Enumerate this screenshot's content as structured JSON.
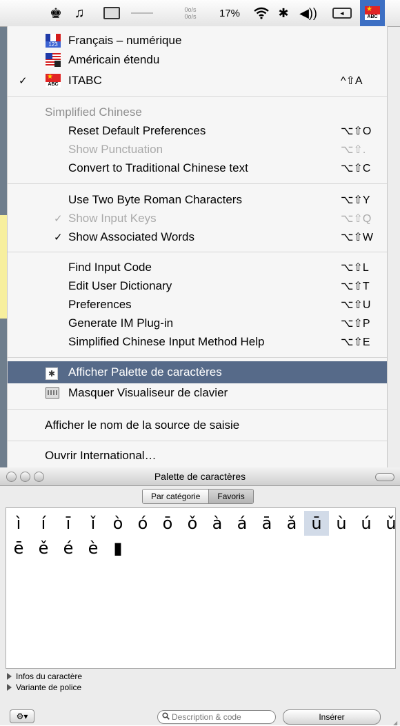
{
  "menubar": {
    "speaker_icon": "♚",
    "music_icon": "♫",
    "net_up": "0o/s",
    "net_down": "0o/s",
    "battery": "17%",
    "wifi_icon": "wifi-icon",
    "bluetooth_icon": "✱",
    "volume_icon": "◀))",
    "plug_label": "◂"
  },
  "input_sources": [
    {
      "label": "Français – numérique",
      "flag": "fr",
      "flag_text": "123",
      "checked": false,
      "shortcut": ""
    },
    {
      "label": "Américain étendu",
      "flag": "us",
      "checked": false,
      "shortcut": ""
    },
    {
      "label": "ITABC",
      "flag": "cn",
      "flag_text": "ABC",
      "checked": true,
      "shortcut": "^⇧A"
    }
  ],
  "check_mark": "✓",
  "section_header": "Simplified Chinese",
  "group1": [
    {
      "label": "Reset Default Preferences",
      "shortcut": "⌥⇧O",
      "disabled": false
    },
    {
      "label": "Show Punctuation",
      "shortcut": "⌥⇧.",
      "disabled": true
    },
    {
      "label": "Convert to Traditional Chinese text",
      "shortcut": "⌥⇧C",
      "disabled": false
    }
  ],
  "group2": [
    {
      "label": "Use Two Byte Roman Characters",
      "shortcut": "⌥⇧Y",
      "disabled": false,
      "checked": false
    },
    {
      "label": "Show Input Keys",
      "shortcut": "⌥⇧Q",
      "disabled": true,
      "checked": true
    },
    {
      "label": "Show Associated Words",
      "shortcut": "⌥⇧W",
      "disabled": false,
      "checked": true
    }
  ],
  "group3": [
    {
      "label": "Find Input Code",
      "shortcut": "⌥⇧L"
    },
    {
      "label": "Edit User Dictionary",
      "shortcut": "⌥⇧T"
    },
    {
      "label": "Preferences",
      "shortcut": "⌥⇧U"
    },
    {
      "label": "Generate IM Plug-in",
      "shortcut": "⌥⇧P"
    },
    {
      "label": "Simplified Chinese Input Method Help",
      "shortcut": "⌥⇧E"
    }
  ],
  "palette_items": {
    "show_palette": "Afficher Palette de caractères",
    "hide_keyboard_viewer": "Masquer Visualiseur de clavier"
  },
  "show_source_name": "Afficher le nom de la source de saisie",
  "open_international": "Ouvrir International…",
  "palette": {
    "title": "Palette de caractères",
    "tabs": [
      "Par catégorie",
      "Favoris"
    ],
    "active_tab": 1,
    "rows": [
      [
        "ì",
        "í",
        "ī",
        "ǐ",
        "ò",
        "ó",
        "ō",
        "ǒ",
        "à",
        "á",
        "ā",
        "ǎ",
        "ū",
        "ù",
        "ú",
        "ǔ"
      ],
      [
        "ē",
        "ě",
        "é",
        "è",
        "▮"
      ]
    ],
    "selected": "ū",
    "disclosure": [
      "Infos du caractère",
      "Variante de police"
    ],
    "gear_label": "⚙▾",
    "search_icon": "🔍",
    "search_placeholder": "Description & code",
    "insert_label": "Insérer"
  }
}
